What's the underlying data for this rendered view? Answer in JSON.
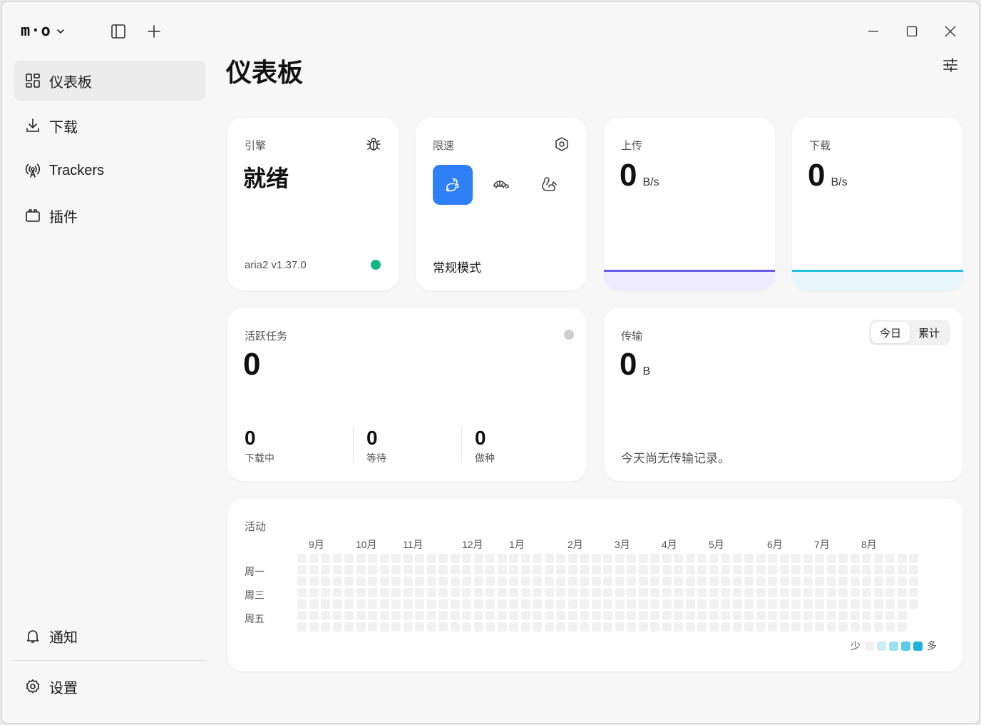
{
  "app": {
    "logo": "m·o"
  },
  "page": {
    "title": "仪表板"
  },
  "sidebar": {
    "items": [
      {
        "label": "仪表板",
        "icon": "grid-icon",
        "active": true
      },
      {
        "label": "下载",
        "icon": "download-icon"
      },
      {
        "label": "Trackers",
        "icon": "antenna-icon"
      },
      {
        "label": "插件",
        "icon": "plugin-icon"
      }
    ],
    "bottom": [
      {
        "label": "通知",
        "icon": "bell-icon"
      },
      {
        "label": "设置",
        "icon": "gear-icon"
      }
    ]
  },
  "engine": {
    "label": "引擎",
    "status": "就绪",
    "version": "aria2 v1.37.0",
    "status_color": "#10b981"
  },
  "speed_limit": {
    "label": "限速",
    "mode": "常规模式",
    "active_color": "#2f7ff7"
  },
  "upload": {
    "label": "上传",
    "value": "0",
    "unit": "B/s",
    "color": "#6b5ce7",
    "fill": "#eeecfc"
  },
  "download": {
    "label": "下载",
    "value": "0",
    "unit": "B/s",
    "color": "#22c2e0",
    "fill": "#e7f7fb"
  },
  "tasks": {
    "label": "活跃任务",
    "value": "0",
    "stats": [
      {
        "value": "0",
        "label": "下载中"
      },
      {
        "value": "0",
        "label": "等待"
      },
      {
        "value": "0",
        "label": "做种"
      }
    ]
  },
  "transfer": {
    "label": "传输",
    "value": "0",
    "unit": "B",
    "tabs": [
      {
        "label": "今日",
        "active": true
      },
      {
        "label": "累计"
      }
    ],
    "empty": "今天尚无传输记录。"
  },
  "activity": {
    "label": "活动",
    "months": [
      "9月",
      "10月",
      "11月",
      "12月",
      "1月",
      "2月",
      "3月",
      "4月",
      "5月",
      "6月",
      "7月",
      "8月"
    ],
    "days": [
      "周一",
      "周三",
      "周五"
    ],
    "legend_low": "少",
    "legend_high": "多",
    "legend_colors": [
      "#f1f1f1",
      "#cdeef8",
      "#9be0f2",
      "#5ccbea",
      "#1eb2e0"
    ],
    "empty_color": "#f1f1f1"
  }
}
